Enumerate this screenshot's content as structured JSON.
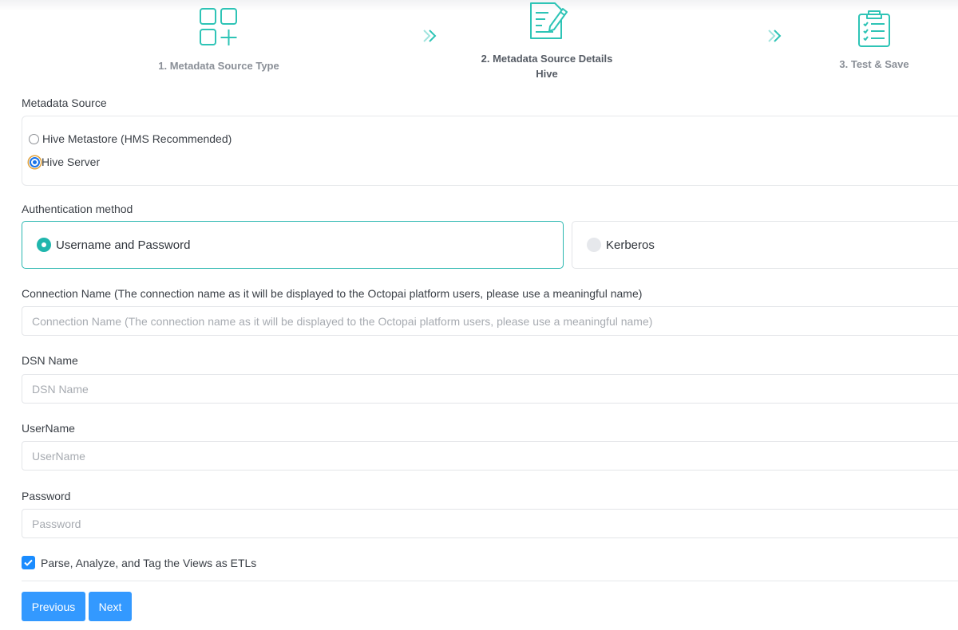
{
  "colors": {
    "accent_teal": "#20b6ad",
    "primary_blue": "#3399ff",
    "radio_blue": "#1a73e8"
  },
  "stepper": {
    "steps": [
      {
        "label": "1. Metadata Source Type",
        "icon": "grid-plus-icon",
        "active": false
      },
      {
        "label": "2. Metadata Source Details",
        "sublabel": "Hive",
        "icon": "document-edit-icon",
        "active": true
      },
      {
        "label": "3. Test & Save",
        "icon": "clipboard-checklist-icon",
        "active": false
      }
    ],
    "separator_icon": "double-chevron-right-icon"
  },
  "metadata_source": {
    "label": "Metadata Source",
    "options": [
      {
        "label": "Hive Metastore (HMS Recommended)",
        "selected": false
      },
      {
        "label": "Hive Server",
        "selected": true
      }
    ]
  },
  "auth": {
    "label": "Authentication method",
    "options": [
      {
        "label": "Username and Password",
        "selected": true
      },
      {
        "label": "Kerberos",
        "selected": false
      }
    ]
  },
  "fields": {
    "connection_name": {
      "label": "Connection Name (The connection name as it will be displayed to the Octopai platform users, please use a meaningful name)",
      "placeholder": "Connection Name (The connection name as it will be displayed to the Octopai platform users, please use a meaningful name)",
      "value": ""
    },
    "dsn_name": {
      "label": "DSN Name",
      "placeholder": "DSN Name",
      "value": ""
    },
    "username": {
      "label": "UserName",
      "placeholder": "UserName",
      "value": ""
    },
    "password": {
      "label": "Password",
      "placeholder": "Password",
      "value": ""
    }
  },
  "parse_option": {
    "label": "Parse, Analyze, and Tag the Views as ETLs",
    "checked": true
  },
  "buttons": {
    "previous": "Previous",
    "next": "Next"
  }
}
